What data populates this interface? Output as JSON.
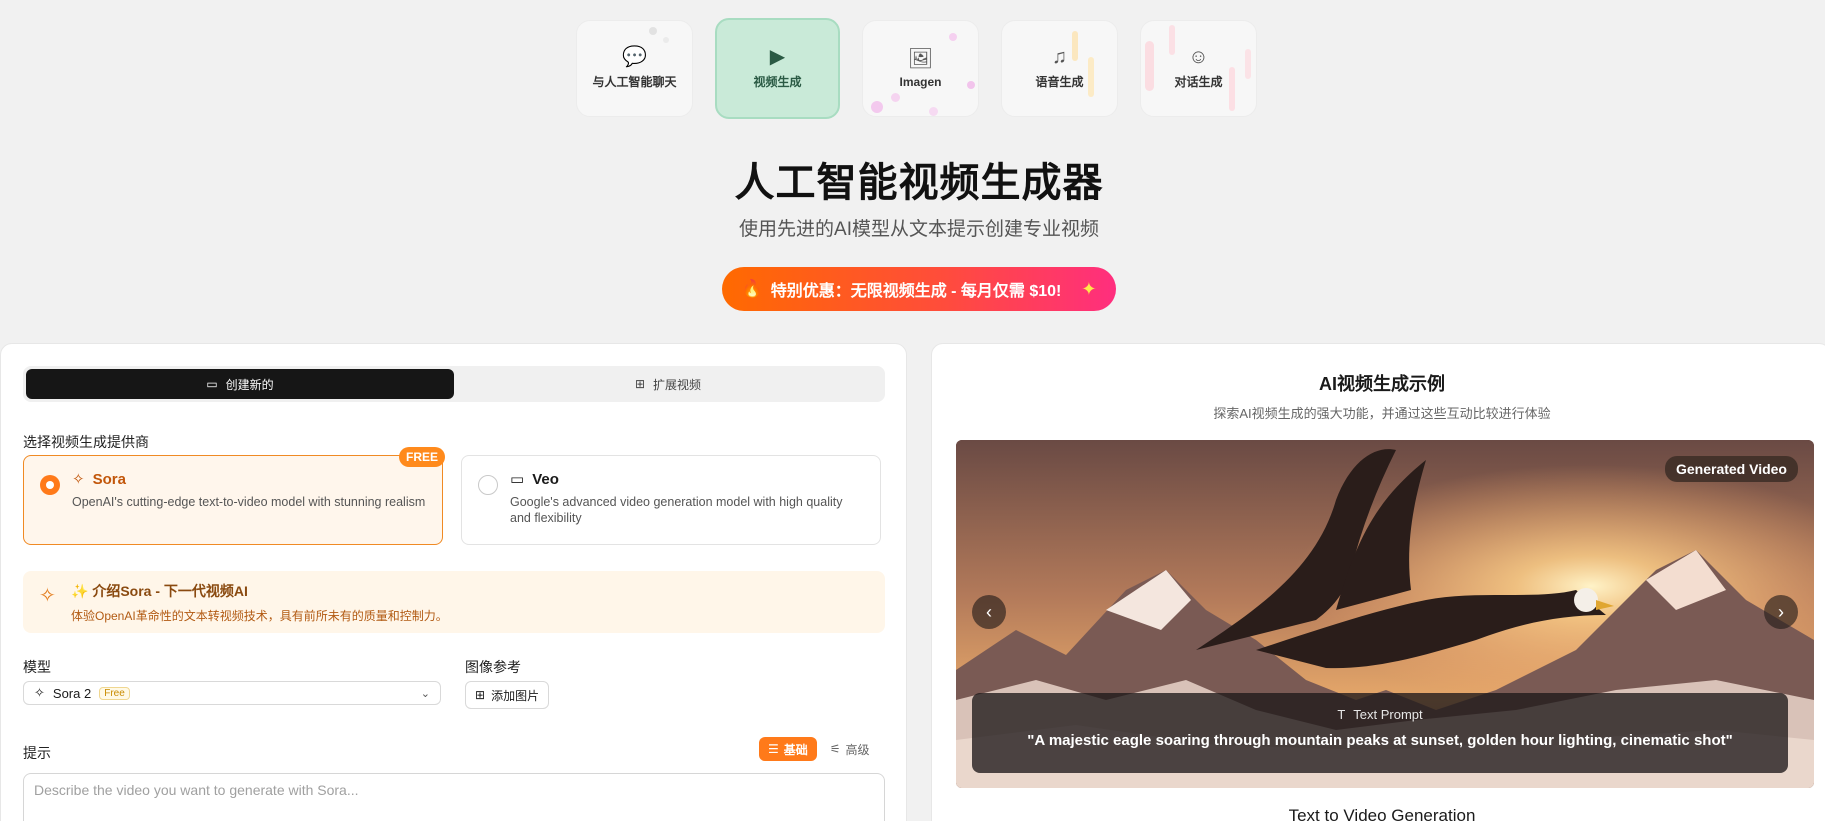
{
  "tools": [
    {
      "icon": "chat-icon",
      "glyph": "💬",
      "label": "与人工智能聊天",
      "active": false
    },
    {
      "icon": "video-spark-icon",
      "glyph": "▶",
      "label": "视频生成",
      "active": true
    },
    {
      "icon": "image-spark-icon",
      "glyph": "🖼",
      "label": "Imagen",
      "active": false
    },
    {
      "icon": "audio-wave-icon",
      "glyph": "♫",
      "label": "语音生成",
      "active": false
    },
    {
      "icon": "dialogue-spark-icon",
      "glyph": "☺",
      "label": "对话生成",
      "active": false
    }
  ],
  "hero": {
    "title": "人工智能视频生成器",
    "subtitle": "使用先进的AI模型从文本提示创建专业视频",
    "promo": "特别优惠：无限视频生成 - 每月仅需 $10!",
    "promo_fire": "🔥",
    "promo_spark": "✦"
  },
  "left": {
    "tabs": {
      "create": "创建新的",
      "extend": "扩展视频",
      "create_icon": "▭",
      "extend_icon": "⊞"
    },
    "provider_label": "选择视频生成提供商",
    "providers": [
      {
        "name": "Sora",
        "desc": "OpenAI's cutting-edge text-to-video model with stunning realism",
        "badge": "FREE",
        "icon": "✧"
      },
      {
        "name": "Veo",
        "desc": "Google's advanced video generation model with high quality and flexibility",
        "icon": "▭"
      }
    ],
    "intro": {
      "icon": "✧",
      "title": "✨ 介绍Sora - 下一代视频AI",
      "desc": "体验OpenAI革命性的文本转视频技术，具有前所未有的质量和控制力。"
    },
    "model_label": "模型",
    "model_value": "Sora 2",
    "model_badge": "Free",
    "model_icon": "✧",
    "chevron": "⌄",
    "image_ref_label": "图像参考",
    "add_image": "添加图片",
    "add_image_icon": "⊞",
    "prompt_label": "提示",
    "mode_basic": "基础",
    "mode_advanced": "高级",
    "mode_basic_icon": "☰",
    "mode_advanced_icon": "⚟",
    "prompt_placeholder": "Describe the video you want to generate with Sora..."
  },
  "right": {
    "title": "AI视频生成示例",
    "subtitle": "探索AI视频生成的强大功能，并通过这些互动比较进行体验",
    "badge": "Generated Video",
    "prev": "‹",
    "next": "›",
    "caption_label": "Text Prompt",
    "caption_icon": "T",
    "caption_text": "\"A majestic eagle soaring through mountain peaks at sunset, golden hour lighting, cinematic shot\"",
    "footer": "Text to Video Generation"
  },
  "colors": {
    "accent": "#ff7a1a",
    "active_tile": "#c9ead8",
    "promo_start": "#ff6a00",
    "promo_end": "#ff2e7e"
  }
}
